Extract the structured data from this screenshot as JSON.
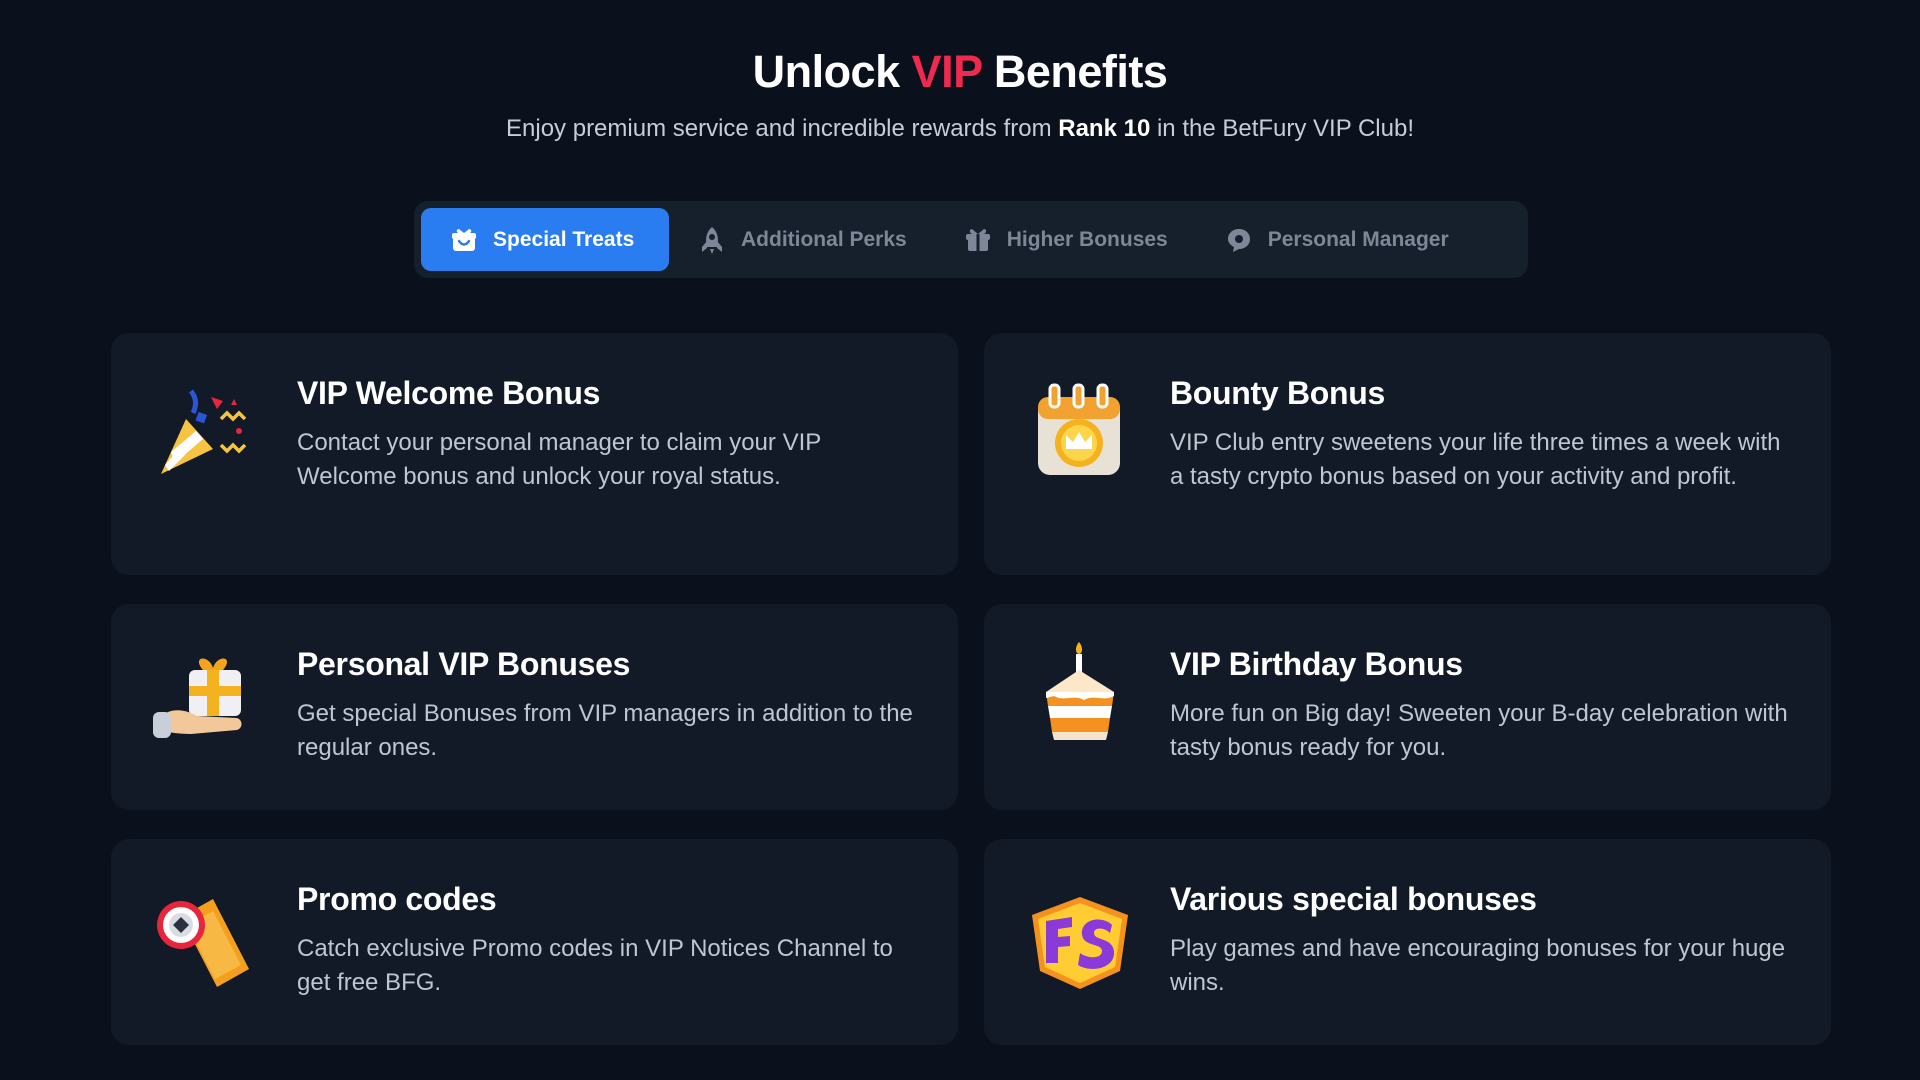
{
  "header": {
    "title_part1": "Unlock",
    "title_accent": "VIP",
    "title_part2": "Benefits",
    "subtitle_part1": "Enjoy premium service and incredible rewards from",
    "subtitle_rank": "Rank 10",
    "subtitle_part2": "in the BetFury VIP Club!"
  },
  "tabs": [
    {
      "label": "Special Treats",
      "icon": "gift-box-icon",
      "active": true
    },
    {
      "label": "Additional Perks",
      "icon": "rocket-icon",
      "active": false
    },
    {
      "label": "Higher Bonuses",
      "icon": "gift-icon",
      "active": false
    },
    {
      "label": "Personal Manager",
      "icon": "chat-bubble-icon",
      "active": false
    }
  ],
  "cards": [
    {
      "title": "VIP Welcome Bonus",
      "description": "Contact your personal manager to claim your VIP Welcome bonus and unlock your royal status.",
      "icon": "party-popper-icon"
    },
    {
      "title": "Bounty Bonus",
      "description": "VIP Club entry sweetens your life three times a week with a tasty crypto bonus based on your activity and profit.",
      "icon": "calendar-crown-icon"
    },
    {
      "title": "Personal VIP Bonuses",
      "description": "Get special Bonuses from VIP managers in addition to the regular ones.",
      "icon": "hand-gift-icon"
    },
    {
      "title": "VIP Birthday Bonus",
      "description": "More fun on Big day! Sweeten your B-day celebration with tasty bonus ready for you.",
      "icon": "birthday-cake-icon"
    },
    {
      "title": "Promo codes",
      "description": "Catch exclusive Promo codes in VIP Notices Channel to get free BFG.",
      "icon": "ticket-icon"
    },
    {
      "title": "Various special bonuses",
      "description": "Play games and have encouraging bonuses for your huge wins.",
      "icon": "fs-badge-icon"
    }
  ],
  "colors": {
    "background": "#0b111c",
    "card": "#121a27",
    "accent_red": "#ef2a4e",
    "tab_active": "#2a7df0"
  }
}
